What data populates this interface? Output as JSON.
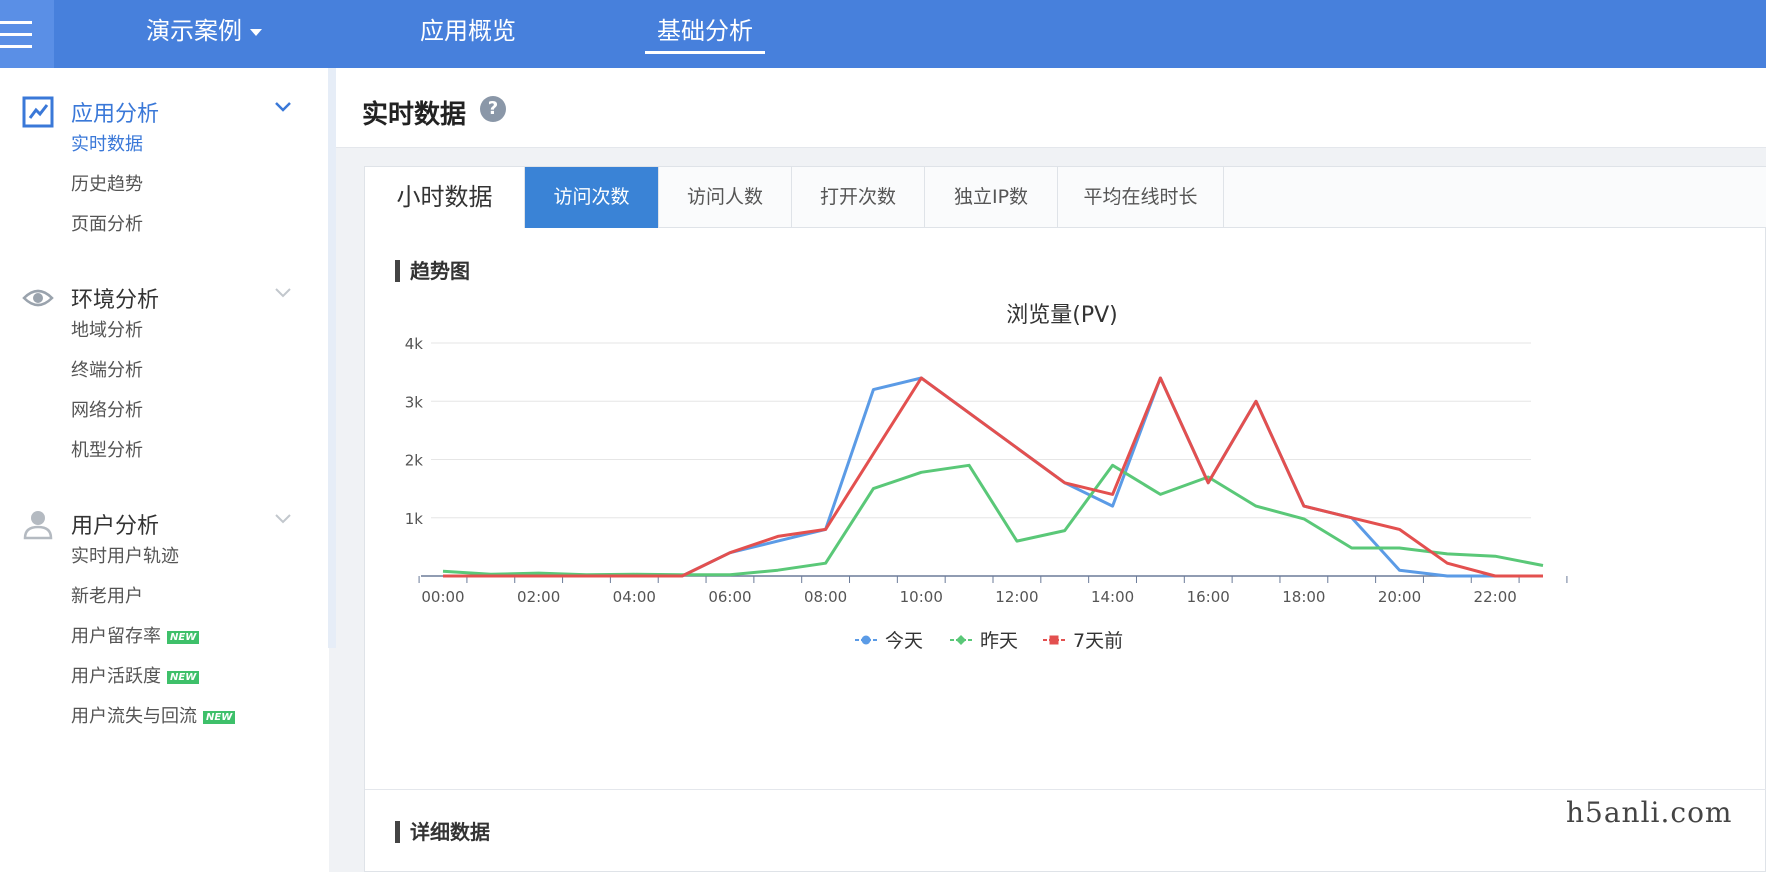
{
  "topbar": {
    "case_label": "演示案例",
    "nav": [
      "应用概览",
      "基础分析"
    ]
  },
  "sidebar": {
    "groups": [
      {
        "label": "应用分析",
        "icon": "line-chart-icon",
        "items": [
          "实时数据",
          "历史趋势",
          "页面分析"
        ]
      },
      {
        "label": "环境分析",
        "icon": "eye-icon",
        "items": [
          "地域分析",
          "终端分析",
          "网络分析",
          "机型分析"
        ]
      },
      {
        "label": "用户分析",
        "icon": "user-icon",
        "items": [
          "实时用户轨迹",
          "新老用户",
          "用户留存率",
          "用户活跃度",
          "用户流失与回流"
        ]
      }
    ],
    "new_badge": "NEW"
  },
  "main": {
    "title": "实时数据",
    "help": "?",
    "tabs_head": "小时数据",
    "tabs": [
      "访问次数",
      "访问人数",
      "打开次数",
      "独立IP数",
      "平均在线时长"
    ],
    "trend_title": "趋势图",
    "detail_title": "详细数据"
  },
  "watermark": "h5anli.com",
  "colors": {
    "primary": "#4780dc",
    "today": "#5b9be6",
    "yesterday": "#5ac878",
    "week_ago": "#e3504f"
  },
  "chart_data": {
    "type": "line",
    "title": "浏览量(PV)",
    "x": [
      "00:00",
      "01:00",
      "02:00",
      "03:00",
      "04:00",
      "05:00",
      "06:00",
      "07:00",
      "08:00",
      "09:00",
      "10:00",
      "11:00",
      "12:00",
      "13:00",
      "14:00",
      "15:00",
      "16:00",
      "17:00",
      "18:00",
      "19:00",
      "20:00",
      "21:00",
      "22:00",
      "23:00"
    ],
    "xticks": [
      "00:00",
      "02:00",
      "04:00",
      "06:00",
      "08:00",
      "10:00",
      "12:00",
      "14:00",
      "16:00",
      "18:00",
      "20:00",
      "22:00"
    ],
    "ylim": [
      0,
      4000
    ],
    "yticks": [
      "1k",
      "2k",
      "3k",
      "4k"
    ],
    "series": [
      {
        "name": "今天",
        "values": [
          0,
          0,
          0,
          0,
          0,
          0,
          400,
          600,
          800,
          3200,
          3400,
          null,
          null,
          1600,
          1200,
          3400,
          1600,
          3000,
          1200,
          1000,
          100,
          0,
          0,
          0
        ]
      },
      {
        "name": "昨天",
        "values": [
          80,
          30,
          50,
          20,
          30,
          20,
          20,
          100,
          220,
          1500,
          1780,
          1900,
          600,
          780,
          1900,
          1400,
          1700,
          1200,
          980,
          480,
          480,
          380,
          340,
          180
        ]
      },
      {
        "name": "7天前",
        "values": [
          0,
          0,
          0,
          0,
          0,
          0,
          400,
          680,
          800,
          2100,
          3400,
          null,
          null,
          1600,
          1400,
          3400,
          1600,
          3000,
          1200,
          1000,
          800,
          220,
          0,
          0
        ]
      }
    ],
    "legend": "bottom-center",
    "grid": true
  }
}
